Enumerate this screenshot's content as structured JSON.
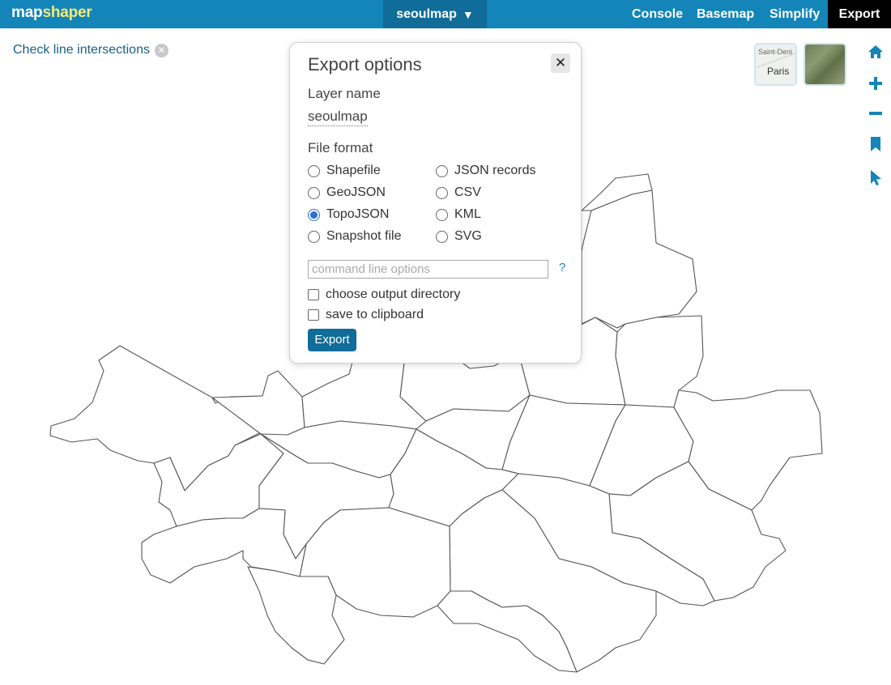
{
  "app": {
    "logo_part1": "map",
    "logo_part2": "shaper"
  },
  "header": {
    "layer_menu_label": "seoulmap",
    "layer_menu_arrow": "▼",
    "nav": {
      "console": "Console",
      "basemap": "Basemap",
      "simplify": "Simplify",
      "export": "Export"
    },
    "active_nav": "Export"
  },
  "intersections": {
    "label": "Check line intersections",
    "close_icon": "close-circle-icon"
  },
  "basemaps": {
    "street_label_top": "Saint-Deni",
    "street_label_city": "Paris",
    "satellite_icon": "satellite-thumbnail"
  },
  "tools": [
    "home-icon",
    "zoom-in-icon",
    "zoom-out-icon",
    "bookmark-icon",
    "pointer-icon"
  ],
  "colors": {
    "header_bg": "#1385b8",
    "header_active": "#106c98",
    "export_active": "#000000",
    "logo_accent": "#f4ea7a",
    "map_stroke": "#555555"
  },
  "dialog": {
    "title": "Export options",
    "close_glyph": "✕",
    "layer_name_label": "Layer name",
    "layer_name_value": "seoulmap",
    "file_format_label": "File format",
    "formats_left": [
      "Shapefile",
      "GeoJSON",
      "TopoJSON",
      "Snapshot file"
    ],
    "formats_right": [
      "JSON records",
      "CSV",
      "KML",
      "SVG"
    ],
    "selected_format": "TopoJSON",
    "command_placeholder": "command line options",
    "command_value": "",
    "help_glyph": "?",
    "option_output_dir": "choose output directory",
    "option_clipboard": "save to clipboard",
    "export_button": "Export"
  }
}
